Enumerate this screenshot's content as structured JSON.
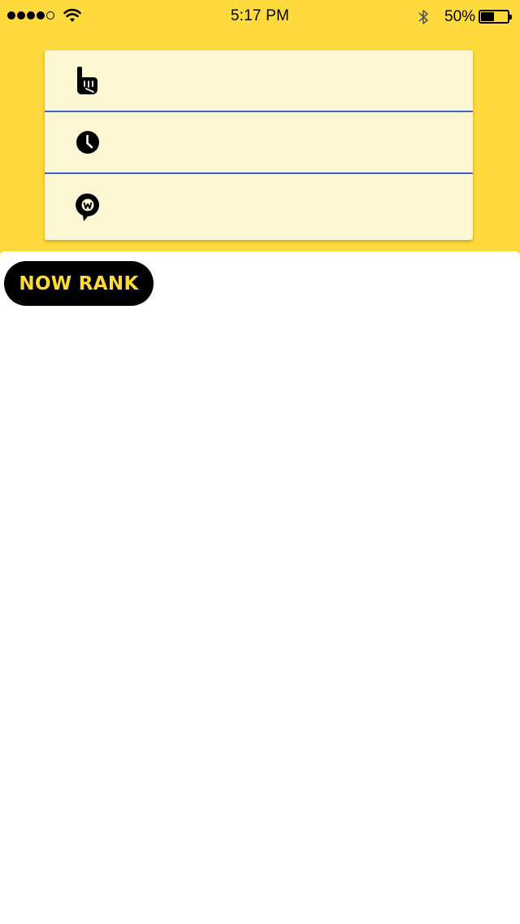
{
  "status_bar": {
    "signal_dots_filled": 4,
    "signal_dots_total": 5,
    "time": "5:17 PM",
    "battery_percent_text": "50%",
    "battery_level": 0.5,
    "icons": [
      "signal-icon",
      "wifi-icon",
      "bluetooth-icon",
      "battery-icon"
    ]
  },
  "menu": {
    "items": [
      {
        "icon": "hand-pointer-icon"
      },
      {
        "icon": "clock-icon"
      },
      {
        "icon": "location-pin-w-icon"
      }
    ],
    "divider_color": "#3d62c8",
    "background_color": "#fef7d6"
  },
  "main": {
    "rank_button_label": "NOW RANK"
  },
  "colors": {
    "accent_yellow": "#ffda3c",
    "button_black": "#000000",
    "button_text": "#ffd83a"
  }
}
